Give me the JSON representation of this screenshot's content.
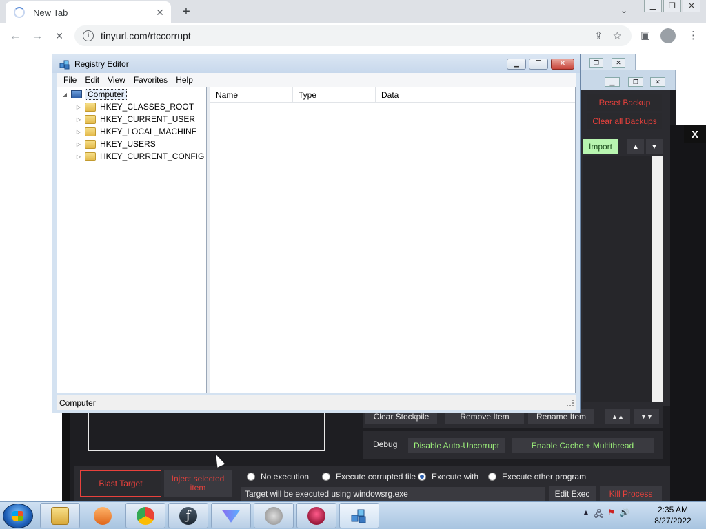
{
  "browser": {
    "tab_title": "New Tab",
    "tab_close": "✕",
    "new_tab": "+",
    "url": "tinyurl.com/rtccorrupt",
    "back": "←",
    "forward": "→",
    "reload": "✕"
  },
  "rtc": {
    "reset_backup": "Reset Backup",
    "clear_backups": "Clear all Backups",
    "import": "Import",
    "close_x": "X",
    "clear_stockpile": "Clear Stockpile",
    "remove_item": "Remove Item",
    "rename_item": "Rename Item",
    "move_up": "▲▲",
    "move_down": "▼▼",
    "debug_label": "Debug",
    "disable_auto_uncorrupt": "Disable Auto-Uncorrupt",
    "enable_cache": "Enable Cache + Multithread",
    "blast_target": "Blast Target",
    "inject_selected": "Inject selected item",
    "radio_no_exec": "No execution",
    "radio_exec_corrupted": "Execute corrupted file",
    "radio_exec_with": "Execute with",
    "radio_exec_other": "Execute other program",
    "exec_info": "Target will be executed using windowsrg.exe",
    "edit_exec": "Edit Exec",
    "kill_process": "Kill Process"
  },
  "regedit": {
    "title": "Registry Editor",
    "menu": [
      "File",
      "Edit",
      "View",
      "Favorites",
      "Help"
    ],
    "root": "Computer",
    "keys": [
      "HKEY_CLASSES_ROOT",
      "HKEY_CURRENT_USER",
      "HKEY_LOCAL_MACHINE",
      "HKEY_USERS",
      "HKEY_CURRENT_CONFIG"
    ],
    "columns": [
      "Name",
      "Type",
      "Data"
    ],
    "status": "Computer"
  },
  "taskbar": {
    "time": "2:35 AM",
    "date": "8/27/2022"
  },
  "colors": {
    "accent_red": "#e8413c",
    "accent_green": "#9cf07a",
    "import_green": "#b8f5b0"
  }
}
